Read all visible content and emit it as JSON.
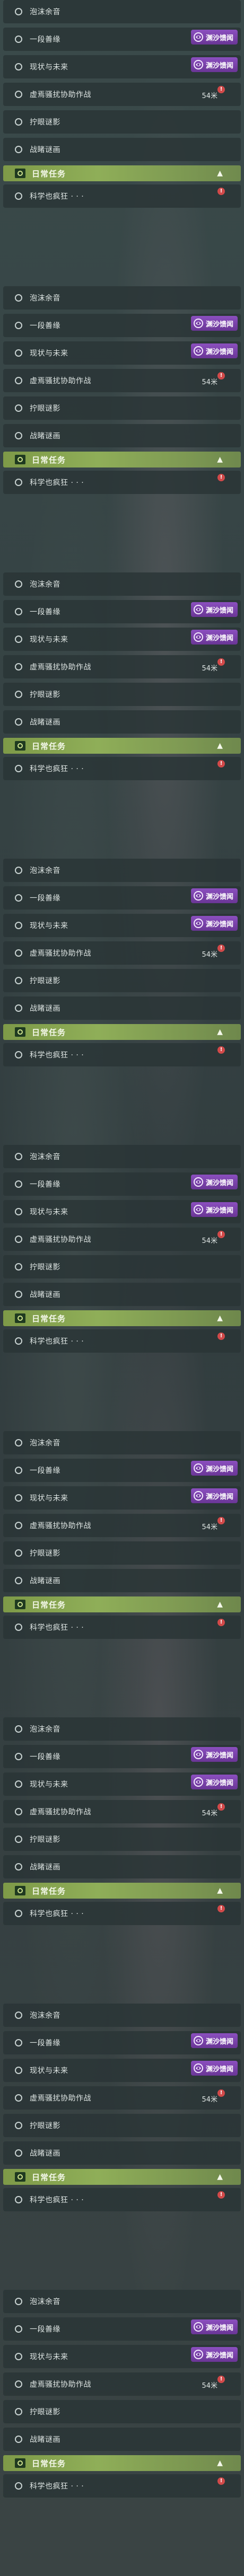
{
  "blocks": [
    {
      "rows": [
        {
          "label": "泡沫余音",
          "badge": null
        },
        {
          "label": "一段善缘",
          "badge": "渊沙馈闻"
        },
        {
          "label": "现状与未来",
          "badge": "渊沙馈闻"
        },
        {
          "label": "虚焉骚扰协助作战",
          "dist": "54米",
          "alert": "!"
        },
        {
          "label": "拧眼谜影"
        },
        {
          "label": "战睹谜画"
        }
      ],
      "section": {
        "title": "日常任务",
        "arrow": "▲"
      },
      "extra": {
        "label": "科学也疯狂 · · ·",
        "alert": "!"
      }
    },
    {
      "rows": [
        {
          "label": "泡沫余音",
          "badge": null
        },
        {
          "label": "一段善缘",
          "badge": "渊沙馈闻"
        },
        {
          "label": "现状与未来",
          "badge": "渊沙馈闻"
        },
        {
          "label": "虚焉骚扰协助作战",
          "dist": "54米",
          "alert": "!"
        },
        {
          "label": "拧眼谜影"
        },
        {
          "label": "战睹谜画"
        }
      ],
      "section": {
        "title": "日常任务",
        "arrow": "▲"
      },
      "extra": {
        "label": "科学也疯狂 · · ·",
        "alert": "!"
      }
    },
    {
      "rows": [
        {
          "label": "泡沫余音",
          "badge": null
        },
        {
          "label": "一段善缘",
          "badge": "渊沙馈闻"
        },
        {
          "label": "现状与未来",
          "badge": "渊沙馈闻"
        },
        {
          "label": "虚焉骚扰协助作战",
          "dist": "54米",
          "alert": "!"
        },
        {
          "label": "拧眼谜影"
        },
        {
          "label": "战睹谜画"
        }
      ],
      "section": {
        "title": "日常任务",
        "arrow": "▲"
      },
      "extra": {
        "label": "科学也疯狂 · · ·",
        "alert": "!"
      }
    },
    {
      "rows": [
        {
          "label": "泡沫余音",
          "badge": null
        },
        {
          "label": "一段善缘",
          "badge": "渊沙馈闻"
        },
        {
          "label": "现状与未来",
          "badge": "渊沙馈闻"
        },
        {
          "label": "虚焉骚扰协助作战",
          "dist": "54米",
          "alert": "!"
        },
        {
          "label": "拧眼谜影"
        },
        {
          "label": "战睹谜画"
        }
      ],
      "section": {
        "title": "日常任务",
        "arrow": "▲"
      },
      "extra": {
        "label": "科学也疯狂 · · ·",
        "alert": "!"
      }
    },
    {
      "rows": [
        {
          "label": "泡沫余音",
          "badge": null
        },
        {
          "label": "一段善缘",
          "badge": "渊沙馈闻"
        },
        {
          "label": "现状与未来",
          "badge": "渊沙馈闻"
        },
        {
          "label": "虚焉骚扰协助作战",
          "dist": "54米",
          "alert": "!"
        },
        {
          "label": "拧眼谜影"
        },
        {
          "label": "战睹谜画"
        }
      ],
      "section": {
        "title": "日常任务",
        "arrow": "▲"
      },
      "extra": {
        "label": "科学也疯狂 · · ·",
        "alert": "!"
      }
    },
    {
      "rows": [
        {
          "label": "泡沫余音",
          "badge": null
        },
        {
          "label": "一段善缘",
          "badge": "渊沙馈闻"
        },
        {
          "label": "现状与未来",
          "badge": "渊沙馈闻"
        },
        {
          "label": "虚焉骚扰协助作战",
          "dist": "54米",
          "alert": "!"
        },
        {
          "label": "拧眼谜影"
        },
        {
          "label": "战睹谜画"
        }
      ],
      "section": {
        "title": "日常任务",
        "arrow": "▲"
      },
      "extra": {
        "label": "科学也疯狂 · · ·",
        "alert": "!"
      }
    },
    {
      "rows": [
        {
          "label": "泡沫余音",
          "badge": null
        },
        {
          "label": "一段善缘",
          "badge": "渊沙馈闻"
        },
        {
          "label": "现状与未来",
          "badge": "渊沙馈闻"
        },
        {
          "label": "虚焉骚扰协助作战",
          "dist": "54米",
          "alert": "!"
        },
        {
          "label": "拧眼谜影"
        },
        {
          "label": "战睹谜画"
        }
      ],
      "section": {
        "title": "日常任务",
        "arrow": "▲"
      },
      "extra": {
        "label": "科学也疯狂 · · ·",
        "alert": "!"
      }
    },
    {
      "rows": [
        {
          "label": "泡沫余音",
          "badge": null
        },
        {
          "label": "一段善缘",
          "badge": "渊沙馈闻"
        },
        {
          "label": "现状与未来",
          "badge": "渊沙馈闻"
        },
        {
          "label": "虚焉骚扰协助作战",
          "dist": "54米",
          "alert": "!"
        },
        {
          "label": "拧眼谜影"
        },
        {
          "label": "战睹谜画"
        }
      ],
      "section": {
        "title": "日常任务",
        "arrow": "▲"
      },
      "extra": {
        "label": "科学也疯狂 · · ·",
        "alert": "!"
      }
    },
    {
      "rows": [
        {
          "label": "泡沫余音",
          "badge": null
        },
        {
          "label": "一段善缘",
          "badge": "渊沙馈闻"
        },
        {
          "label": "现状与未来",
          "badge": "渊沙馈闻"
        },
        {
          "label": "虚焉骚扰协助作战",
          "dist": "54米",
          "alert": "!"
        },
        {
          "label": "拧眼谜影"
        },
        {
          "label": "战睹谜画"
        }
      ],
      "section": {
        "title": "日常任务",
        "arrow": "▲"
      },
      "extra": {
        "label": "科学也疯狂 · · ·",
        "alert": "!"
      }
    }
  ],
  "colors": {
    "row_bg": "#2a3436",
    "header_green": "#8fae58",
    "badge_purple": "#7a42ab",
    "alert_red": "#d24a4a"
  }
}
